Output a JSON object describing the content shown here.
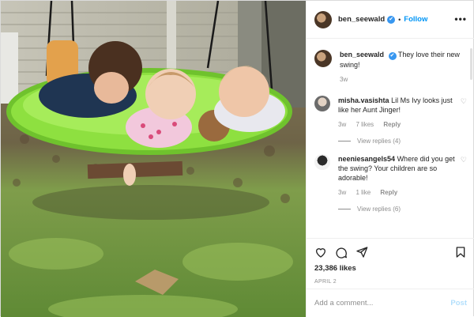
{
  "header": {
    "username": "ben_seewald",
    "verified_mark": "✔",
    "dot": "•",
    "follow_label": "Follow",
    "more_label": "•••"
  },
  "caption": {
    "username": "ben_seewald",
    "text": "They love their new swing!",
    "age": "3w"
  },
  "comments": [
    {
      "username": "misha.vasishta",
      "text": "Lil Ms Ivy looks just like her Aunt Jinger!",
      "age": "3w",
      "likes": "7 likes",
      "reply_label": "Reply",
      "view_replies": "View replies (4)"
    },
    {
      "username": "neeniesangels54",
      "text": "Where did you get the swing? Your children are so adorable!",
      "age": "3w",
      "likes": "1 like",
      "reply_label": "Reply",
      "view_replies": "View replies (6)"
    }
  ],
  "actions": {
    "like_icon": "heart-icon",
    "comment_icon": "comment-icon",
    "share_icon": "share-icon",
    "save_icon": "bookmark-icon",
    "likes_count": "23,386 likes",
    "date": "APRIL 2"
  },
  "add_comment": {
    "placeholder": "Add a comment...",
    "post_label": "Post"
  },
  "colors": {
    "accent": "#0095f6",
    "verified": "#3897f0",
    "swing": "#8ee040",
    "grass": "#7aa84a"
  }
}
